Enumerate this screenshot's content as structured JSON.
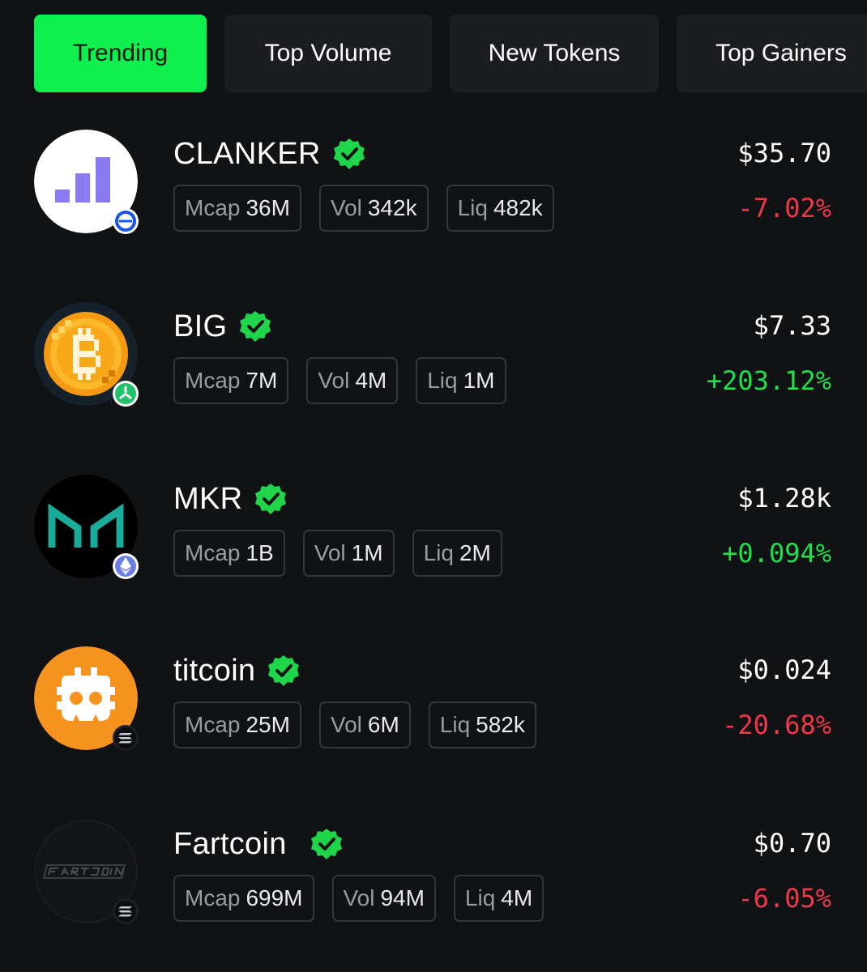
{
  "tabs": [
    {
      "label": "Trending",
      "active": true
    },
    {
      "label": "Top Volume",
      "active": false
    },
    {
      "label": "New Tokens",
      "active": false
    },
    {
      "label": "Top Gainers",
      "active": false
    }
  ],
  "stat_labels": {
    "mcap": "Mcap",
    "vol": "Vol",
    "liq": "Liq"
  },
  "colors": {
    "positive": "#1ee24b",
    "negative": "#f0384b",
    "accent": "#0ff04f"
  },
  "tokens": [
    {
      "name": "CLANKER",
      "verified": true,
      "icon": "clanker-bars-icon",
      "chain_icon": "base-chain-icon",
      "mcap": "36M",
      "vol": "342k",
      "liq": "482k",
      "price": "$35.70",
      "change": "-7.02%",
      "direction": "negative"
    },
    {
      "name": "BIG",
      "verified": true,
      "icon": "bitcoin-coin-icon",
      "chain_icon": "green-chain-icon",
      "mcap": "7M",
      "vol": "4M",
      "liq": "1M",
      "price": "$7.33",
      "change": "+203.12%",
      "direction": "positive"
    },
    {
      "name": "MKR",
      "verified": true,
      "icon": "maker-logo-icon",
      "chain_icon": "ethereum-chain-icon",
      "mcap": "1B",
      "vol": "1M",
      "liq": "2M",
      "price": "$1.28k",
      "change": "+0.094%",
      "direction": "positive"
    },
    {
      "name": "titcoin",
      "verified": true,
      "icon": "titcoin-logo-icon",
      "chain_icon": "solana-chain-icon",
      "mcap": "25M",
      "vol": "6M",
      "liq": "582k",
      "price": "$0.024",
      "change": "-20.68%",
      "direction": "negative"
    },
    {
      "name": "Fartcoin",
      "verified": true,
      "icon": "fartcoin-logo-icon",
      "chain_icon": "solana-chain-icon",
      "mcap": "699M",
      "vol": "94M",
      "liq": "4M",
      "price": "$0.70",
      "change": "-6.05%",
      "direction": "negative"
    }
  ]
}
